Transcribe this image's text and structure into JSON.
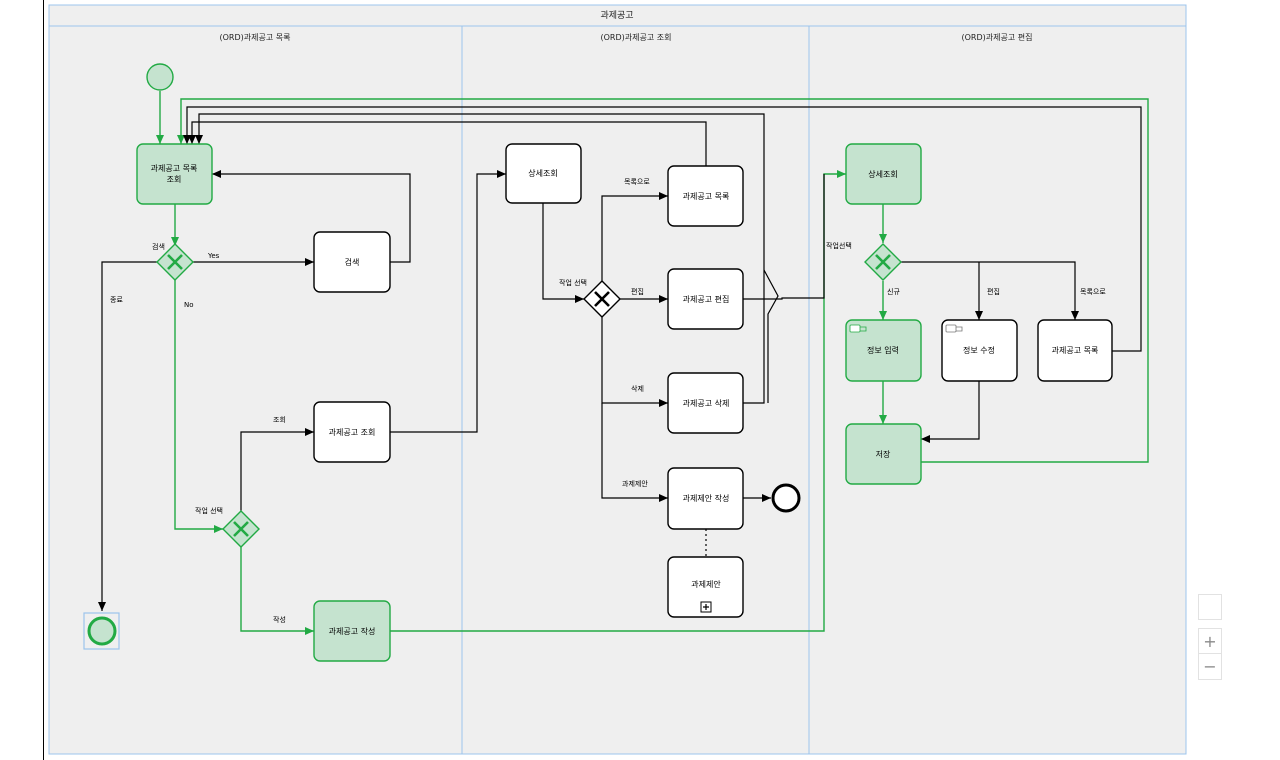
{
  "pool": {
    "title": "과제공고"
  },
  "lanes": [
    {
      "id": "list",
      "title": "(ORD)과제공고 목록"
    },
    {
      "id": "view",
      "title": "(ORD)과제공고 조회"
    },
    {
      "id": "edit",
      "title": "(ORD)과제공고 편집"
    }
  ],
  "tasks": {
    "list_view": "과제공고 목록\n조회",
    "search": "검색",
    "notice_view": "과제공고 조회",
    "notice_write": "과제공고 작성",
    "detail_view": "상세조회",
    "to_list": "과제공고 목록",
    "to_edit": "과제공고 편집",
    "to_delete": "과제공고 삭제",
    "proposal_write": "과제제안 작성",
    "proposal_sub": "과제제안",
    "edit_detail": "상세조회",
    "info_input": "정보 입력",
    "info_modify": "정보 수정",
    "edit_to_list": "과제공고 목록",
    "save": "저장"
  },
  "labels": {
    "search_gw": "검색",
    "yes": "Yes",
    "no": "No",
    "end": "종료",
    "select_task": "작업 선택",
    "view": "조회",
    "write": "작성",
    "view_select": "작업 선택",
    "to_list": "목록으로",
    "edit": "편집",
    "delete": "삭제",
    "proposal": "과제제안",
    "edit_select": "작업선택",
    "new": "신규",
    "modify": "편집",
    "back_to_list": "목록으로"
  },
  "zoom": {
    "in": "+",
    "out": "−"
  },
  "colors": {
    "lane_bg": "#efefef",
    "lane_border": "#9cc4ec",
    "green_fill": "#c5e3cf",
    "green_stroke": "#22aa44",
    "line": "#000000"
  }
}
